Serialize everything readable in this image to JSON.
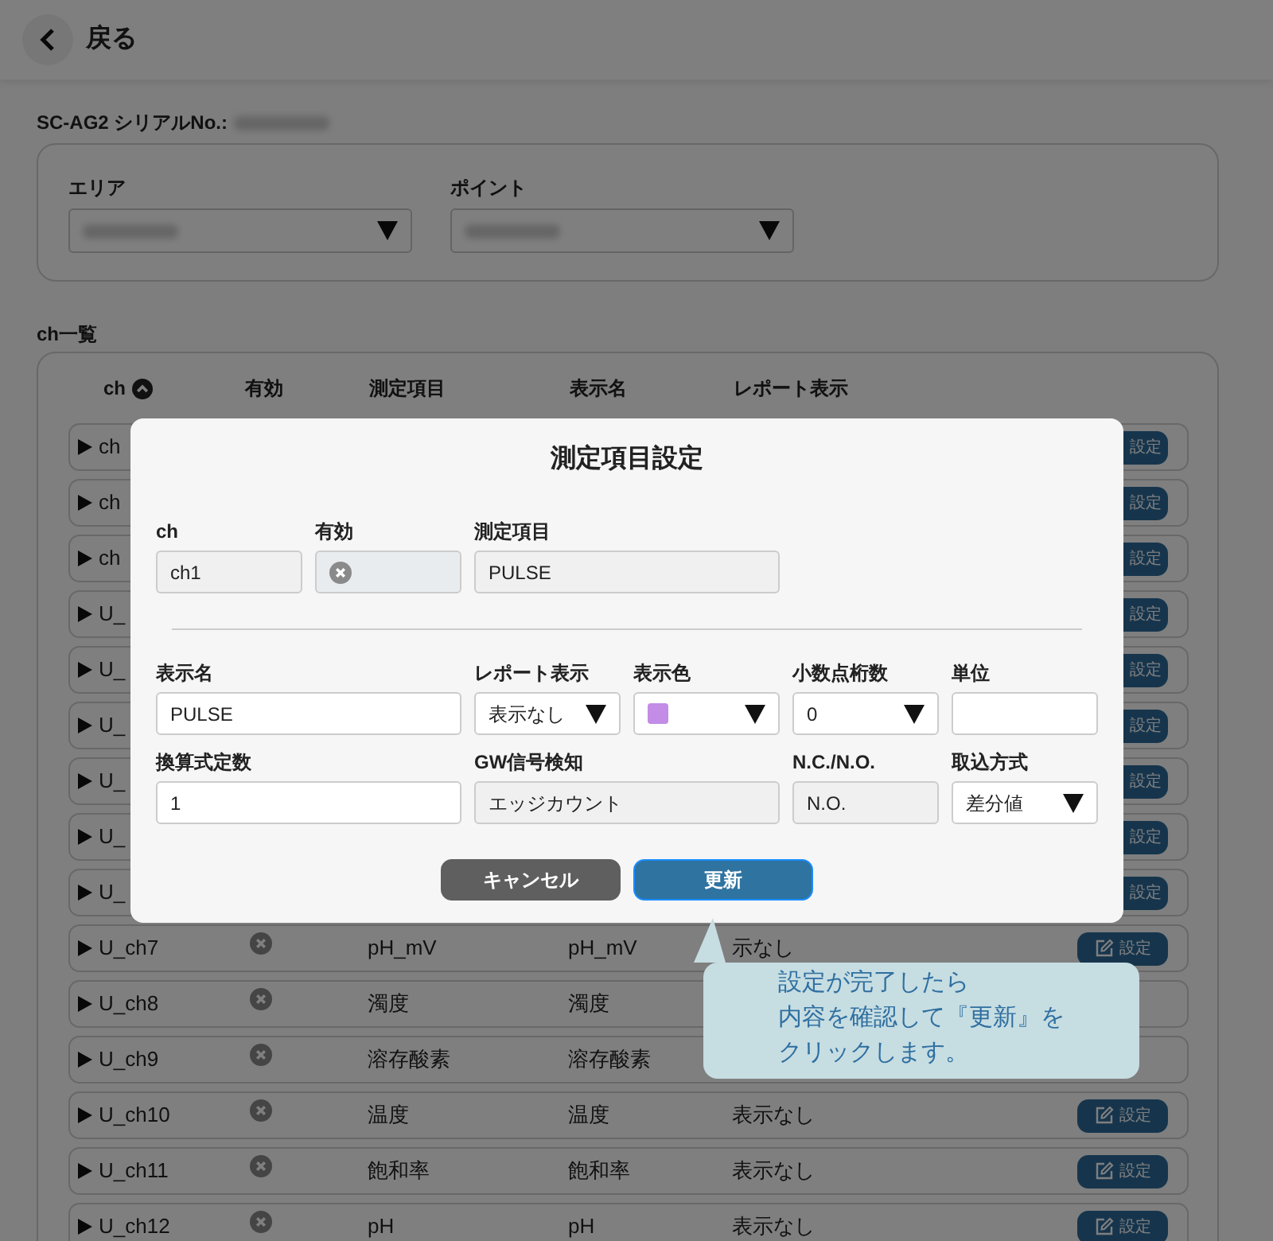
{
  "header": {
    "back_label": "戻る"
  },
  "device": {
    "label": "SC-AG2 シリアルNo.:"
  },
  "filters": [
    {
      "label": "エリア"
    },
    {
      "label": "ポイント"
    }
  ],
  "channel_list": {
    "title": "ch一覧",
    "columns": [
      "ch",
      "有効",
      "測定項目",
      "表示名",
      "レポート表示"
    ],
    "rows": [
      {
        "ch": "ch",
        "covered": true,
        "action": "設定"
      },
      {
        "ch": "ch",
        "covered": true,
        "action": "設定"
      },
      {
        "ch": "ch",
        "covered": true,
        "action": "設定"
      },
      {
        "ch": "U_",
        "covered": true,
        "action": "設定"
      },
      {
        "ch": "U_",
        "covered": true,
        "action": "設定"
      },
      {
        "ch": "U_",
        "covered": true,
        "action": "設定"
      },
      {
        "ch": "U_",
        "covered": true,
        "action": "設定"
      },
      {
        "ch": "U_",
        "covered": true,
        "action": "設定"
      },
      {
        "ch": "U_",
        "covered": true,
        "action": "設定"
      },
      {
        "ch": "U_ch7",
        "covered": false,
        "enabled": false,
        "measurement": "pH_mV",
        "display_name": "pH_mV",
        "report": "示なし",
        "action": "設定"
      },
      {
        "ch": "U_ch8",
        "covered": false,
        "enabled": false,
        "measurement": "濁度",
        "display_name": "濁度"
      },
      {
        "ch": "U_ch9",
        "covered": false,
        "enabled": false,
        "measurement": "溶存酸素",
        "display_name": "溶存酸素"
      },
      {
        "ch": "U_ch10",
        "covered": false,
        "enabled": false,
        "measurement": "温度",
        "display_name": "温度",
        "report": "表示なし",
        "action": "設定"
      },
      {
        "ch": "U_ch11",
        "covered": false,
        "enabled": false,
        "measurement": "飽和率",
        "display_name": "飽和率",
        "report": "表示なし",
        "action": "設定"
      },
      {
        "ch": "U_ch12",
        "covered": false,
        "enabled": false,
        "measurement": "pH",
        "display_name": "pH",
        "report": "表示なし",
        "action": "設定"
      }
    ]
  },
  "dialog": {
    "title": "測定項目設定",
    "groups": [
      [
        {
          "label": "ch",
          "kind": "readonly",
          "value": "ch1"
        },
        {
          "label": "有効",
          "kind": "status",
          "enabled": false
        },
        {
          "label": "測定項目",
          "kind": "readonly",
          "value": "PULSE"
        }
      ],
      [
        {
          "label": "表示名",
          "kind": "input",
          "value": "PULSE"
        },
        {
          "label": "レポート表示",
          "kind": "select",
          "value": "表示なし"
        },
        {
          "label": "表示色",
          "kind": "color-select",
          "color": "#c38ce6"
        },
        {
          "label": "小数点桁数",
          "kind": "select",
          "value": "0"
        },
        {
          "label": "単位",
          "kind": "input"
        },
        {
          "label": "換算式定数",
          "kind": "input",
          "value": "1"
        },
        {
          "label": "GW信号検知",
          "kind": "readonly",
          "value": "エッジカウント"
        },
        {
          "label": "N.C./N.O.",
          "kind": "readonly",
          "value": "N.O."
        },
        {
          "label": "取込方式",
          "kind": "select",
          "value": "差分値"
        }
      ]
    ],
    "buttons": [
      {
        "label": "キャンセル",
        "kind": "secondary"
      },
      {
        "label": "更新",
        "kind": "primary"
      }
    ]
  },
  "callout": {
    "lines": [
      "設定が完了したら",
      "内容を確認して『更新』を",
      "クリックします。"
    ]
  }
}
